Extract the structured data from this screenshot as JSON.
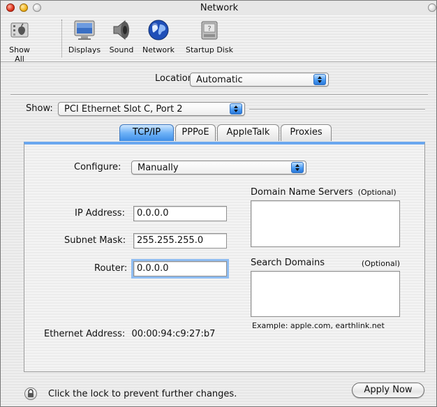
{
  "window": {
    "title": "Network"
  },
  "toolbar": {
    "items": [
      {
        "label": "Show All",
        "icon": "apple-icon"
      },
      {
        "label": "Displays",
        "icon": "displays-icon"
      },
      {
        "label": "Sound",
        "icon": "sound-icon"
      },
      {
        "label": "Network",
        "icon": "network-globe-icon"
      },
      {
        "label": "Startup Disk",
        "icon": "startup-disk-icon"
      }
    ]
  },
  "location": {
    "label": "Location:",
    "value": "Automatic"
  },
  "show": {
    "label": "Show:",
    "value": "PCI Ethernet Slot C, Port 2"
  },
  "tabs": [
    {
      "label": "TCP/IP",
      "active": true
    },
    {
      "label": "PPPoE",
      "active": false
    },
    {
      "label": "AppleTalk",
      "active": false
    },
    {
      "label": "Proxies",
      "active": false
    }
  ],
  "tcpip": {
    "configure": {
      "label": "Configure:",
      "value": "Manually"
    },
    "ip_address": {
      "label": "IP Address:",
      "value": "0.0.0.0"
    },
    "subnet_mask": {
      "label": "Subnet Mask:",
      "value": "255.255.255.0"
    },
    "router": {
      "label": "Router:",
      "value": "0.0.0.0"
    },
    "dns": {
      "label": "Domain Name Servers",
      "optional": "(Optional)"
    },
    "search_domains": {
      "label": "Search Domains",
      "optional": "(Optional)",
      "example": "Example: apple.com, earthlink.net"
    },
    "ethernet_address": {
      "label": "Ethernet Address:",
      "value": "00:00:94:c9:27:b7"
    }
  },
  "footer": {
    "lock_text": "Click the lock to prevent further changes.",
    "apply_label": "Apply Now"
  },
  "colors": {
    "accent": "#4a9cf5",
    "tab_active": "#6fb2f7",
    "focus": "#8fbdf2"
  }
}
